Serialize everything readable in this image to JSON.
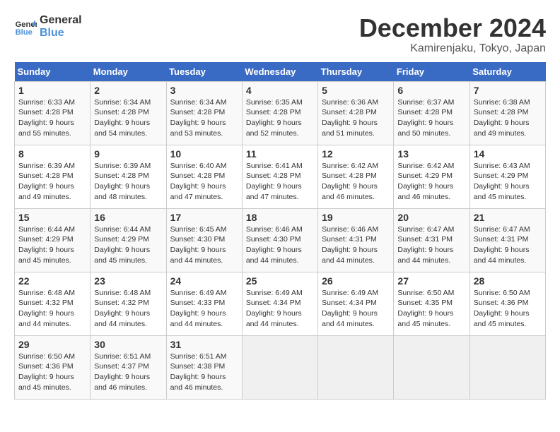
{
  "header": {
    "logo_line1": "General",
    "logo_line2": "Blue",
    "month": "December 2024",
    "location": "Kamirenjaku, Tokyo, Japan"
  },
  "weekdays": [
    "Sunday",
    "Monday",
    "Tuesday",
    "Wednesday",
    "Thursday",
    "Friday",
    "Saturday"
  ],
  "weeks": [
    [
      {
        "day": "1",
        "sunrise": "Sunrise: 6:33 AM",
        "sunset": "Sunset: 4:28 PM",
        "daylight": "Daylight: 9 hours and 55 minutes."
      },
      {
        "day": "2",
        "sunrise": "Sunrise: 6:34 AM",
        "sunset": "Sunset: 4:28 PM",
        "daylight": "Daylight: 9 hours and 54 minutes."
      },
      {
        "day": "3",
        "sunrise": "Sunrise: 6:34 AM",
        "sunset": "Sunset: 4:28 PM",
        "daylight": "Daylight: 9 hours and 53 minutes."
      },
      {
        "day": "4",
        "sunrise": "Sunrise: 6:35 AM",
        "sunset": "Sunset: 4:28 PM",
        "daylight": "Daylight: 9 hours and 52 minutes."
      },
      {
        "day": "5",
        "sunrise": "Sunrise: 6:36 AM",
        "sunset": "Sunset: 4:28 PM",
        "daylight": "Daylight: 9 hours and 51 minutes."
      },
      {
        "day": "6",
        "sunrise": "Sunrise: 6:37 AM",
        "sunset": "Sunset: 4:28 PM",
        "daylight": "Daylight: 9 hours and 50 minutes."
      },
      {
        "day": "7",
        "sunrise": "Sunrise: 6:38 AM",
        "sunset": "Sunset: 4:28 PM",
        "daylight": "Daylight: 9 hours and 49 minutes."
      }
    ],
    [
      {
        "day": "8",
        "sunrise": "Sunrise: 6:39 AM",
        "sunset": "Sunset: 4:28 PM",
        "daylight": "Daylight: 9 hours and 49 minutes."
      },
      {
        "day": "9",
        "sunrise": "Sunrise: 6:39 AM",
        "sunset": "Sunset: 4:28 PM",
        "daylight": "Daylight: 9 hours and 48 minutes."
      },
      {
        "day": "10",
        "sunrise": "Sunrise: 6:40 AM",
        "sunset": "Sunset: 4:28 PM",
        "daylight": "Daylight: 9 hours and 47 minutes."
      },
      {
        "day": "11",
        "sunrise": "Sunrise: 6:41 AM",
        "sunset": "Sunset: 4:28 PM",
        "daylight": "Daylight: 9 hours and 47 minutes."
      },
      {
        "day": "12",
        "sunrise": "Sunrise: 6:42 AM",
        "sunset": "Sunset: 4:28 PM",
        "daylight": "Daylight: 9 hours and 46 minutes."
      },
      {
        "day": "13",
        "sunrise": "Sunrise: 6:42 AM",
        "sunset": "Sunset: 4:29 PM",
        "daylight": "Daylight: 9 hours and 46 minutes."
      },
      {
        "day": "14",
        "sunrise": "Sunrise: 6:43 AM",
        "sunset": "Sunset: 4:29 PM",
        "daylight": "Daylight: 9 hours and 45 minutes."
      }
    ],
    [
      {
        "day": "15",
        "sunrise": "Sunrise: 6:44 AM",
        "sunset": "Sunset: 4:29 PM",
        "daylight": "Daylight: 9 hours and 45 minutes."
      },
      {
        "day": "16",
        "sunrise": "Sunrise: 6:44 AM",
        "sunset": "Sunset: 4:29 PM",
        "daylight": "Daylight: 9 hours and 45 minutes."
      },
      {
        "day": "17",
        "sunrise": "Sunrise: 6:45 AM",
        "sunset": "Sunset: 4:30 PM",
        "daylight": "Daylight: 9 hours and 44 minutes."
      },
      {
        "day": "18",
        "sunrise": "Sunrise: 6:46 AM",
        "sunset": "Sunset: 4:30 PM",
        "daylight": "Daylight: 9 hours and 44 minutes."
      },
      {
        "day": "19",
        "sunrise": "Sunrise: 6:46 AM",
        "sunset": "Sunset: 4:31 PM",
        "daylight": "Daylight: 9 hours and 44 minutes."
      },
      {
        "day": "20",
        "sunrise": "Sunrise: 6:47 AM",
        "sunset": "Sunset: 4:31 PM",
        "daylight": "Daylight: 9 hours and 44 minutes."
      },
      {
        "day": "21",
        "sunrise": "Sunrise: 6:47 AM",
        "sunset": "Sunset: 4:31 PM",
        "daylight": "Daylight: 9 hours and 44 minutes."
      }
    ],
    [
      {
        "day": "22",
        "sunrise": "Sunrise: 6:48 AM",
        "sunset": "Sunset: 4:32 PM",
        "daylight": "Daylight: 9 hours and 44 minutes."
      },
      {
        "day": "23",
        "sunrise": "Sunrise: 6:48 AM",
        "sunset": "Sunset: 4:32 PM",
        "daylight": "Daylight: 9 hours and 44 minutes."
      },
      {
        "day": "24",
        "sunrise": "Sunrise: 6:49 AM",
        "sunset": "Sunset: 4:33 PM",
        "daylight": "Daylight: 9 hours and 44 minutes."
      },
      {
        "day": "25",
        "sunrise": "Sunrise: 6:49 AM",
        "sunset": "Sunset: 4:34 PM",
        "daylight": "Daylight: 9 hours and 44 minutes."
      },
      {
        "day": "26",
        "sunrise": "Sunrise: 6:49 AM",
        "sunset": "Sunset: 4:34 PM",
        "daylight": "Daylight: 9 hours and 44 minutes."
      },
      {
        "day": "27",
        "sunrise": "Sunrise: 6:50 AM",
        "sunset": "Sunset: 4:35 PM",
        "daylight": "Daylight: 9 hours and 45 minutes."
      },
      {
        "day": "28",
        "sunrise": "Sunrise: 6:50 AM",
        "sunset": "Sunset: 4:36 PM",
        "daylight": "Daylight: 9 hours and 45 minutes."
      }
    ],
    [
      {
        "day": "29",
        "sunrise": "Sunrise: 6:50 AM",
        "sunset": "Sunset: 4:36 PM",
        "daylight": "Daylight: 9 hours and 45 minutes."
      },
      {
        "day": "30",
        "sunrise": "Sunrise: 6:51 AM",
        "sunset": "Sunset: 4:37 PM",
        "daylight": "Daylight: 9 hours and 46 minutes."
      },
      {
        "day": "31",
        "sunrise": "Sunrise: 6:51 AM",
        "sunset": "Sunset: 4:38 PM",
        "daylight": "Daylight: 9 hours and 46 minutes."
      },
      null,
      null,
      null,
      null
    ]
  ]
}
